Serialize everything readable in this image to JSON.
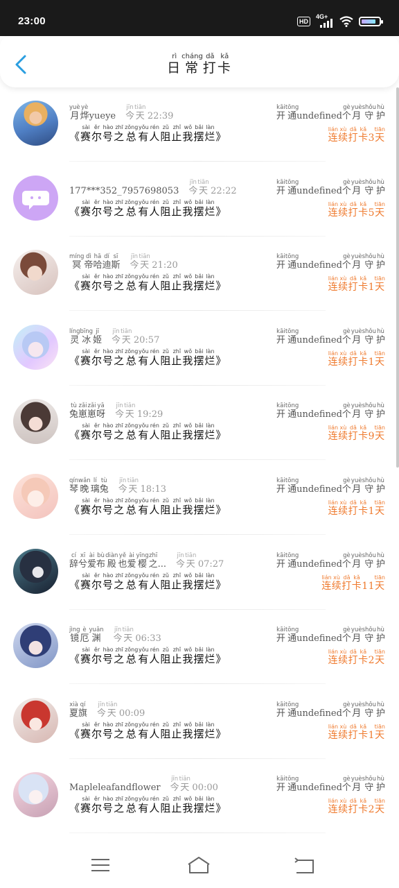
{
  "status_bar": {
    "time": "23:00",
    "hd": "HD",
    "network": "4G+"
  },
  "header": {
    "title": [
      {
        "hz": "日",
        "py": "rì"
      },
      {
        "hz": "常",
        "py": "cháng"
      },
      {
        "hz": "打",
        "py": "dǎ"
      },
      {
        "hz": "卡",
        "py": "kǎ"
      }
    ]
  },
  "message": [
    {
      "hz": "赛",
      "py": "sài"
    },
    {
      "hz": "尔",
      "py": "ěr"
    },
    {
      "hz": "号",
      "py": "hào"
    },
    {
      "hz": "之",
      "py": "zhī"
    },
    {
      "hz": "总",
      "py": "zǒng"
    },
    {
      "hz": "有",
      "py": "yǒu"
    },
    {
      "hz": "人",
      "py": "rén"
    },
    {
      "hz": "阻",
      "py": "zǔ"
    },
    {
      "hz": "止",
      "py": "zhǐ"
    },
    {
      "hz": "我",
      "py": "wǒ"
    },
    {
      "hz": "摆",
      "py": "bǎi"
    },
    {
      "hz": "烂",
      "py": "làn"
    }
  ],
  "today": [
    {
      "hz": "今",
      "py": "jīn"
    },
    {
      "hz": "天",
      "py": "tiān"
    }
  ],
  "guard_text": [
    {
      "hz": "开",
      "py": "kāi"
    },
    {
      "hz": "通",
      "py": "tōng"
    },
    {
      "hz": "undefined",
      "py": ""
    },
    {
      "hz": "个",
      "py": "gè"
    },
    {
      "hz": "月",
      "py": "yuè"
    },
    {
      "hz": "守",
      "py": "shǒu"
    },
    {
      "hz": "护",
      "py": "hù"
    }
  ],
  "streak_text": [
    {
      "hz": "连",
      "py": "lián"
    },
    {
      "hz": "续",
      "py": "xù"
    },
    {
      "hz": "打",
      "py": "dǎ"
    },
    {
      "hz": "卡",
      "py": "kǎ"
    }
  ],
  "streak_suffix": {
    "hz": "天",
    "py": "tiān"
  },
  "items": [
    {
      "name": [
        {
          "hz": "月",
          "py": "yuè"
        },
        {
          "hz": "烨",
          "py": "yè"
        },
        {
          "hz": "yueye",
          "py": ""
        }
      ],
      "time": "22:39",
      "days": "3",
      "avatar": "avatar-1"
    },
    {
      "name": [
        {
          "hz": "177***352_7957698053",
          "py": ""
        }
      ],
      "time": "22:22",
      "days": "5",
      "avatar": "avatar-2"
    },
    {
      "name": [
        {
          "hz": "冥",
          "py": "míng"
        },
        {
          "hz": "帝",
          "py": "dì"
        },
        {
          "hz": "哈",
          "py": "hā"
        },
        {
          "hz": "迪",
          "py": "dí"
        },
        {
          "hz": "斯",
          "py": "sī"
        }
      ],
      "time": "21:20",
      "days": "1",
      "avatar": "avatar-3"
    },
    {
      "name": [
        {
          "hz": "灵",
          "py": "líng"
        },
        {
          "hz": "冰",
          "py": "bīng"
        },
        {
          "hz": "姬",
          "py": "jī"
        }
      ],
      "time": "20:57",
      "days": "1",
      "avatar": "avatar-4"
    },
    {
      "name": [
        {
          "hz": "兔",
          "py": "tù"
        },
        {
          "hz": "崽",
          "py": "zǎi"
        },
        {
          "hz": "崽",
          "py": "zǎi"
        },
        {
          "hz": "呀",
          "py": "yā"
        }
      ],
      "time": "19:29",
      "days": "9",
      "avatar": "avatar-5"
    },
    {
      "name": [
        {
          "hz": "琴",
          "py": "qín"
        },
        {
          "hz": "晚",
          "py": "wǎn"
        },
        {
          "hz": "璃",
          "py": "lí"
        },
        {
          "hz": "兔",
          "py": "tù"
        }
      ],
      "time": "18:13",
      "days": "1",
      "avatar": "avatar-6"
    },
    {
      "name": [
        {
          "hz": "辞",
          "py": "cí"
        },
        {
          "hz": "兮",
          "py": "xī"
        },
        {
          "hz": "爱",
          "py": "ài"
        },
        {
          "hz": "布",
          "py": "bù"
        },
        {
          "hz": "殿",
          "py": "diàn"
        },
        {
          "hz": "也",
          "py": "yě"
        },
        {
          "hz": "爱",
          "py": "ài"
        },
        {
          "hz": "樱",
          "py": "yīng"
        },
        {
          "hz": "之",
          "py": "zhī"
        },
        {
          "hz": "...",
          "py": ""
        }
      ],
      "time": "07:27",
      "days": "11",
      "avatar": "avatar-7"
    },
    {
      "name": [
        {
          "hz": "镜",
          "py": "jìng"
        },
        {
          "hz": "厄",
          "py": "è"
        },
        {
          "hz": "渊",
          "py": "yuān"
        }
      ],
      "time": "06:33",
      "days": "2",
      "avatar": "avatar-8"
    },
    {
      "name": [
        {
          "hz": "夏",
          "py": "xià"
        },
        {
          "hz": "旗",
          "py": "qí"
        }
      ],
      "time": "00:09",
      "days": "1",
      "avatar": "avatar-9"
    },
    {
      "name": [
        {
          "hz": "Mapleleafandflower",
          "py": ""
        }
      ],
      "time": "00:00",
      "days": "2",
      "avatar": "avatar-10"
    }
  ]
}
